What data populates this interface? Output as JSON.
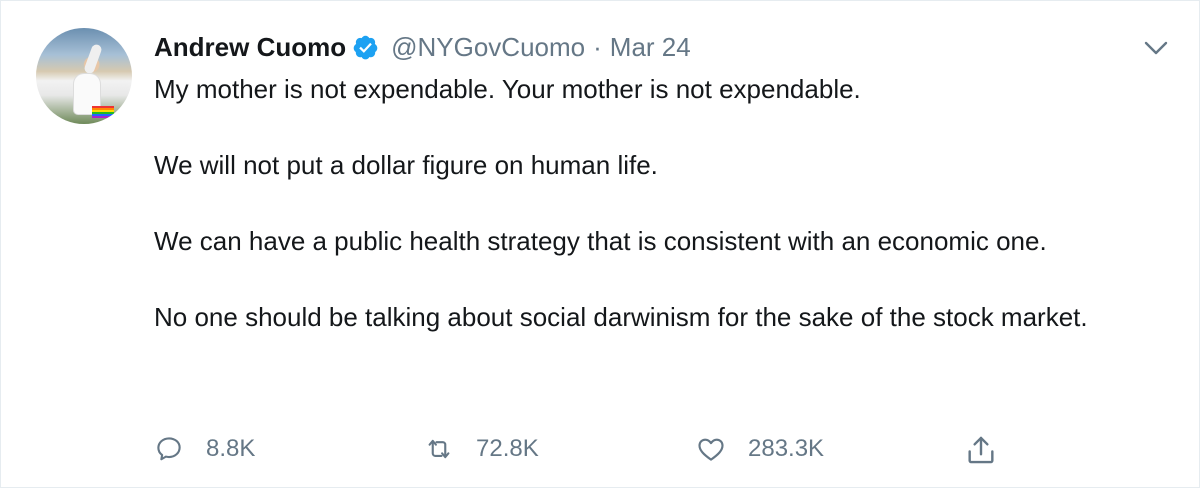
{
  "tweet": {
    "author_name": "Andrew Cuomo",
    "handle": "@NYGovCuomo",
    "separator": "·",
    "date": "Mar 24",
    "paragraphs": [
      "My mother is not expendable. Your mother is not expendable.",
      "We will not put a dollar figure on human life.",
      "We can have a public health strategy that is consistent with an economic one.",
      "No one should be talking about social darwinism for the sake of the stock market."
    ],
    "replies": "8.8K",
    "retweets": "72.8K",
    "likes": "283.3K",
    "verified": true
  },
  "icons": {
    "verified": "verified-badge-icon",
    "caret": "chevron-down-icon",
    "reply": "reply-icon",
    "retweet": "retweet-icon",
    "like": "heart-icon",
    "share": "share-icon"
  },
  "colors": {
    "verified_blue": "#1da1f2",
    "text": "#14171a",
    "secondary": "#657786",
    "border": "#e6ecf0"
  }
}
